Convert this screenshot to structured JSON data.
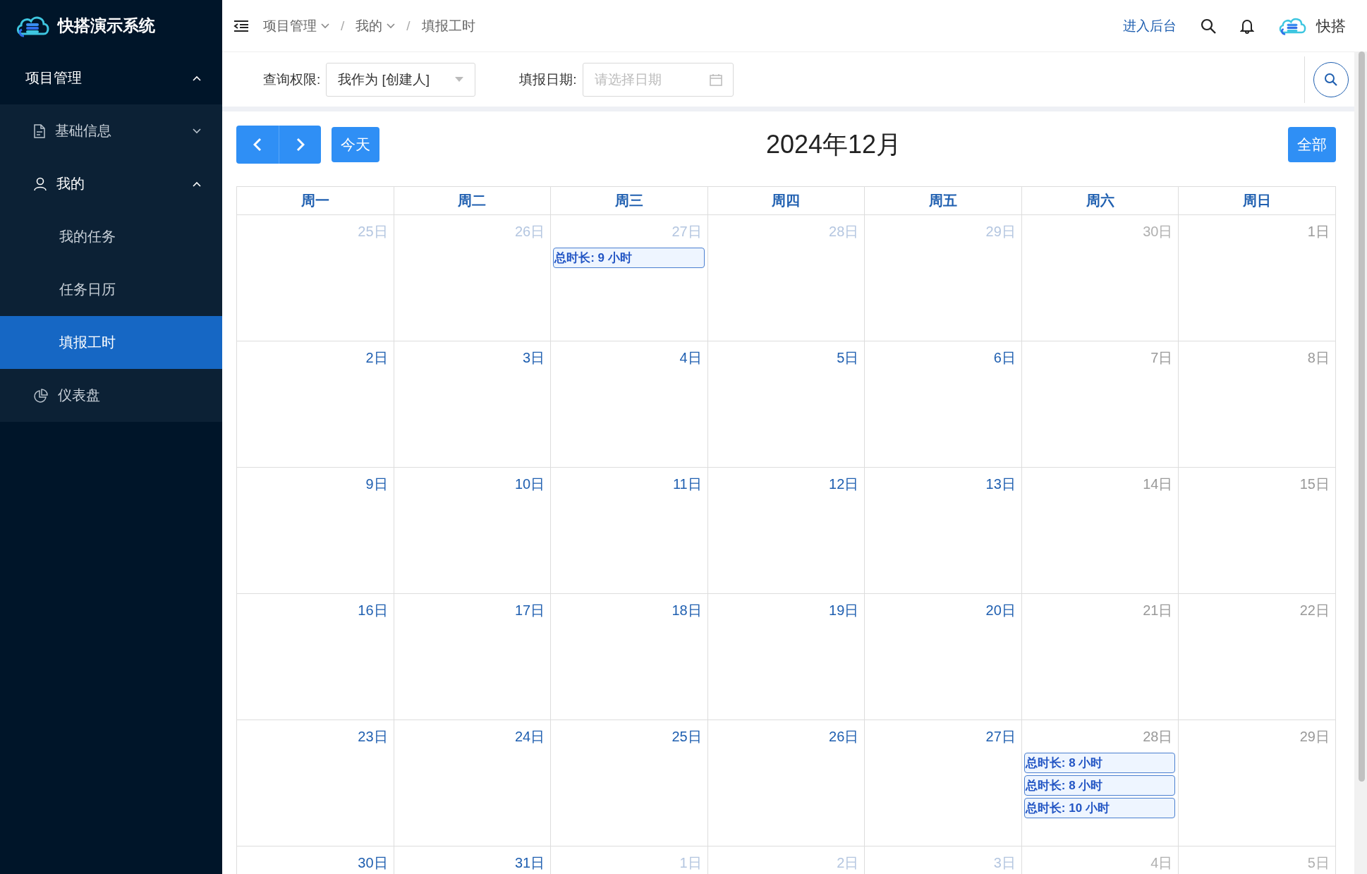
{
  "app": {
    "title": "快搭演示系统"
  },
  "sidebar": {
    "items": [
      {
        "label": "项目管理",
        "expanded": true,
        "selected": false,
        "children": [
          {
            "label": "基础信息",
            "expanded": false,
            "selected": false
          },
          {
            "label": "我的",
            "expanded": true,
            "selected": false,
            "children": [
              {
                "label": "我的任务",
                "selected": false
              },
              {
                "label": "任务日历",
                "selected": false
              },
              {
                "label": "填报工时",
                "selected": true
              }
            ]
          },
          {
            "label": "仪表盘",
            "selected": false
          }
        ]
      }
    ]
  },
  "topbar": {
    "separators": [
      "/",
      "/"
    ],
    "breadcrumb": [
      {
        "label": "项目管理",
        "dropdown": true
      },
      {
        "label": "我的",
        "dropdown": true
      },
      {
        "label": "填报工时",
        "dropdown": false
      }
    ],
    "admin_link": "进入后台",
    "user": "快搭"
  },
  "filters": {
    "scope_label": "查询权限:",
    "scope_value": "我作为 [创建人]",
    "date_label": "填报日期:",
    "date_placeholder": "请选择日期"
  },
  "calendar": {
    "title": "2024年12月",
    "today_button": "今天",
    "all_button": "全部",
    "weekdays": [
      "周一",
      "周二",
      "周三",
      "周四",
      "周五",
      "周六",
      "周日"
    ],
    "weeks": [
      {
        "days": [
          {
            "date": "25日",
            "kind": "other"
          },
          {
            "date": "26日",
            "kind": "other"
          },
          {
            "date": "27日",
            "kind": "other",
            "events": [
              "总时长: 9 小时"
            ]
          },
          {
            "date": "28日",
            "kind": "other"
          },
          {
            "date": "29日",
            "kind": "other"
          },
          {
            "date": "30日",
            "kind": "other_weekend"
          },
          {
            "date": "1日",
            "kind": "weekend"
          }
        ]
      },
      {
        "days": [
          {
            "date": "2日",
            "kind": "current"
          },
          {
            "date": "3日",
            "kind": "current"
          },
          {
            "date": "4日",
            "kind": "current"
          },
          {
            "date": "5日",
            "kind": "current"
          },
          {
            "date": "6日",
            "kind": "current"
          },
          {
            "date": "7日",
            "kind": "weekend"
          },
          {
            "date": "8日",
            "kind": "weekend"
          }
        ]
      },
      {
        "days": [
          {
            "date": "9日",
            "kind": "current"
          },
          {
            "date": "10日",
            "kind": "current"
          },
          {
            "date": "11日",
            "kind": "current"
          },
          {
            "date": "12日",
            "kind": "current"
          },
          {
            "date": "13日",
            "kind": "current"
          },
          {
            "date": "14日",
            "kind": "weekend"
          },
          {
            "date": "15日",
            "kind": "weekend"
          }
        ]
      },
      {
        "days": [
          {
            "date": "16日",
            "kind": "current"
          },
          {
            "date": "17日",
            "kind": "current"
          },
          {
            "date": "18日",
            "kind": "current"
          },
          {
            "date": "19日",
            "kind": "current"
          },
          {
            "date": "20日",
            "kind": "current"
          },
          {
            "date": "21日",
            "kind": "weekend"
          },
          {
            "date": "22日",
            "kind": "weekend"
          }
        ]
      },
      {
        "days": [
          {
            "date": "23日",
            "kind": "current"
          },
          {
            "date": "24日",
            "kind": "current"
          },
          {
            "date": "25日",
            "kind": "current"
          },
          {
            "date": "26日",
            "kind": "current"
          },
          {
            "date": "27日",
            "kind": "current"
          },
          {
            "date": "28日",
            "kind": "weekend",
            "events": [
              "总时长: 8 小时",
              "总时长: 8 小时",
              "总时长: 10 小时"
            ]
          },
          {
            "date": "29日",
            "kind": "weekend"
          }
        ]
      },
      {
        "days": [
          {
            "date": "30日",
            "kind": "current"
          },
          {
            "date": "31日",
            "kind": "current"
          },
          {
            "date": "1日",
            "kind": "other"
          },
          {
            "date": "2日",
            "kind": "other"
          },
          {
            "date": "3日",
            "kind": "other"
          },
          {
            "date": "4日",
            "kind": "other_weekend"
          },
          {
            "date": "5日",
            "kind": "other_weekend"
          }
        ]
      }
    ]
  }
}
